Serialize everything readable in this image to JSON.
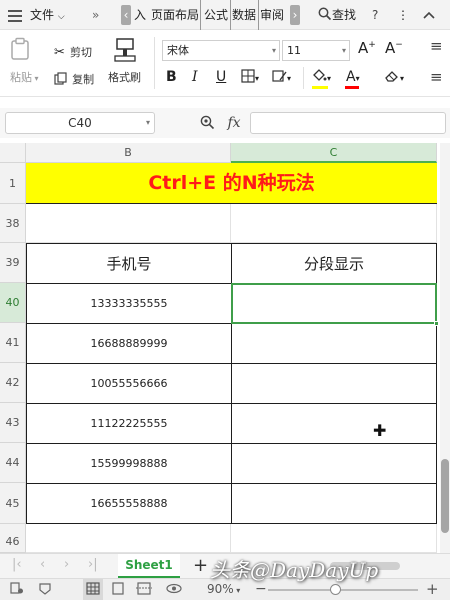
{
  "menubar": {
    "file_label": "文件",
    "tabs": [
      "入",
      "页面布局",
      "公式",
      "数据",
      "审阅"
    ],
    "search_label": "查找",
    "help_label": "?",
    "more_label": "⋮"
  },
  "ribbon": {
    "paste_label": "粘贴",
    "cut_label": "剪切",
    "copy_label": "复制",
    "format_painter_label": "格式刷",
    "font_name": "宋体",
    "font_size": "11",
    "bold_label": "B",
    "italic_label": "I",
    "underline_label": "U",
    "font_color": "#ff0000",
    "fill_color": "#ffff00"
  },
  "formula_bar": {
    "name_box": "C40",
    "fx_label": "fx",
    "formula_value": ""
  },
  "grid": {
    "columns": [
      "B",
      "C"
    ],
    "title": "Ctrl+E 的N种玩法",
    "rows": [
      {
        "num": "38",
        "b": "",
        "c": ""
      },
      {
        "num": "39",
        "b": "手机号",
        "c": "分段显示"
      },
      {
        "num": "40",
        "b": "13333335555",
        "c": ""
      },
      {
        "num": "41",
        "b": "16688889999",
        "c": ""
      },
      {
        "num": "42",
        "b": "10055556666",
        "c": ""
      },
      {
        "num": "43",
        "b": "11122225555",
        "c": ""
      },
      {
        "num": "44",
        "b": "15599998888",
        "c": ""
      },
      {
        "num": "45",
        "b": "16655558888",
        "c": ""
      },
      {
        "num": "46",
        "b": "",
        "c": ""
      }
    ],
    "title_row_num": "1",
    "active_cell": "C40"
  },
  "sheets": {
    "active_sheet": "Sheet1",
    "add_label": "+"
  },
  "watermark": "头条@DayDayUp",
  "statusbar": {
    "zoom": "90%",
    "zoom_minus": "−",
    "zoom_plus": "+"
  },
  "colors": {
    "accent_green": "#3f9e4a",
    "title_bg": "#ffff00",
    "title_text": "#ff1a1a"
  }
}
